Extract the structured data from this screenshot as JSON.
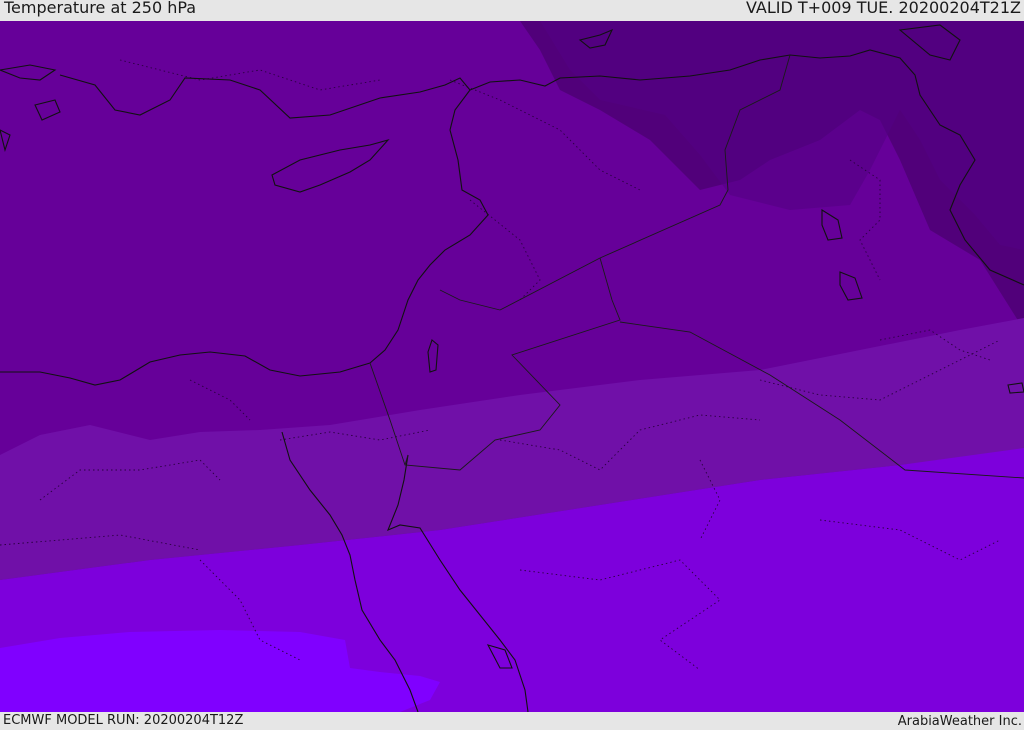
{
  "header": {
    "title": "Temperature at 250 hPa",
    "valid": "VALID T+009 TUE. 20200204T21Z"
  },
  "footer": {
    "model_run": "ECMWF MODEL RUN: 20200204T12Z",
    "credit": "ArabiaWeather Inc."
  },
  "map": {
    "field": "temperature_250hpa",
    "colors": {
      "band_darkest": "#51007a",
      "band_dark": "#5d0090",
      "band_mid": "#660099",
      "band_light": "#7010a8",
      "band_brighter": "#7d00dc",
      "band_brightest": "#8000ff",
      "coastline": "#111111",
      "boundaries": "#222222"
    }
  }
}
